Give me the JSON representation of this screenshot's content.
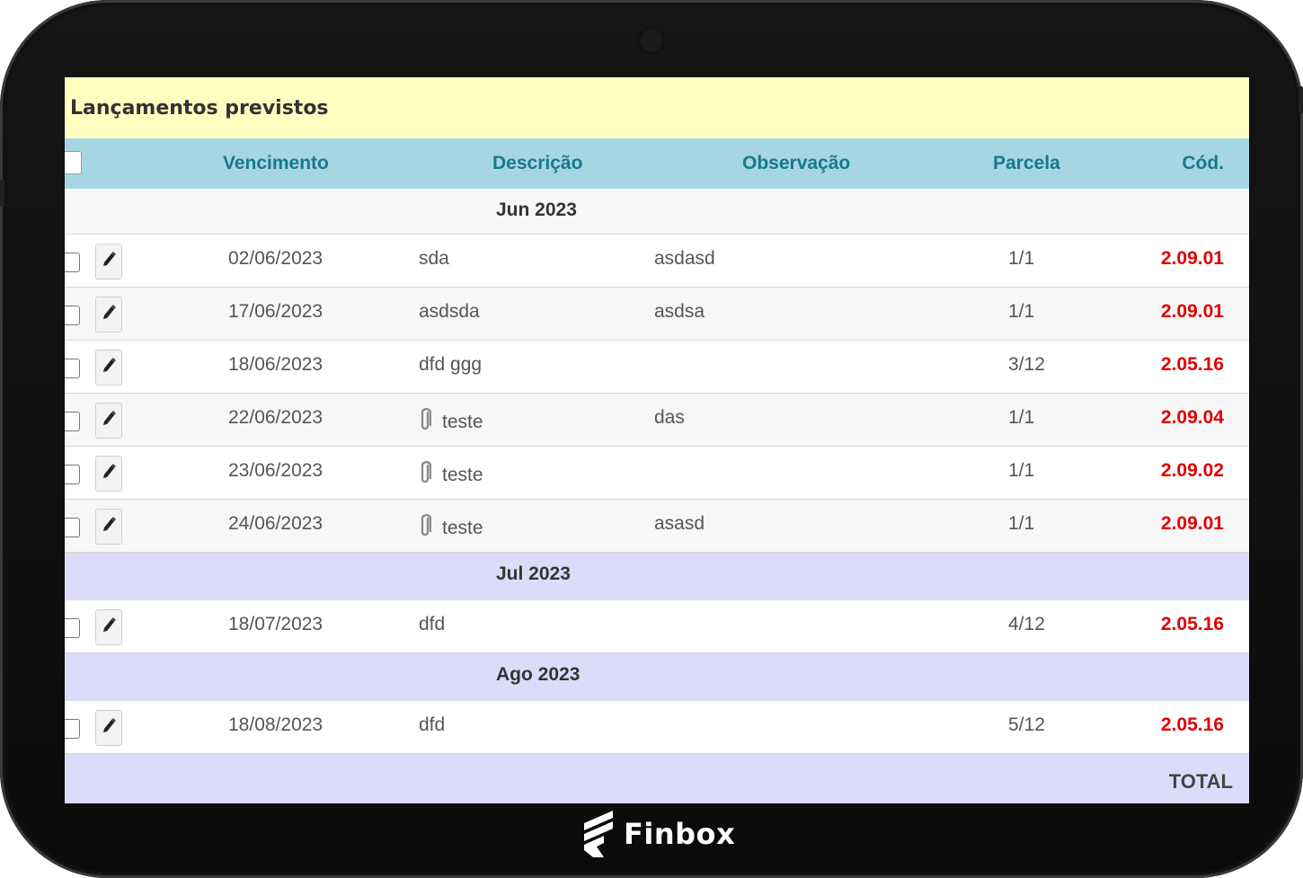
{
  "brand": {
    "name": "Finbox",
    "icon": "finbox-logo-icon"
  },
  "panel": {
    "title": "Lançamentos previstos"
  },
  "columns": {
    "vencimento": "Vencimento",
    "descricao": "Descrição",
    "observacao": "Observação",
    "parcela": "Parcela",
    "cod": "Cód."
  },
  "groups": [
    {
      "label": "Jun 2023",
      "rows": [
        {
          "vencimento": "02/06/2023",
          "descricao": "sda",
          "observacao": "asdasd",
          "parcela": "1/1",
          "cod": "2.09.01",
          "attachment": false
        },
        {
          "vencimento": "17/06/2023",
          "descricao": "asdsda",
          "observacao": "asdsa",
          "parcela": "1/1",
          "cod": "2.09.01",
          "attachment": false
        },
        {
          "vencimento": "18/06/2023",
          "descricao": "dfd ggg",
          "observacao": "",
          "parcela": "3/12",
          "cod": "2.05.16",
          "attachment": false
        },
        {
          "vencimento": "22/06/2023",
          "descricao": "teste",
          "observacao": "das",
          "parcela": "1/1",
          "cod": "2.09.04",
          "attachment": true
        },
        {
          "vencimento": "23/06/2023",
          "descricao": "teste",
          "observacao": "",
          "parcela": "1/1",
          "cod": "2.09.02",
          "attachment": true
        },
        {
          "vencimento": "24/06/2023",
          "descricao": "teste",
          "observacao": "asasd",
          "parcela": "1/1",
          "cod": "2.09.01",
          "attachment": true
        }
      ]
    },
    {
      "label": "Jul 2023",
      "rows": [
        {
          "vencimento": "18/07/2023",
          "descricao": "dfd",
          "observacao": "",
          "parcela": "4/12",
          "cod": "2.05.16",
          "attachment": false
        }
      ]
    },
    {
      "label": "Ago 2023",
      "rows": [
        {
          "vencimento": "18/08/2023",
          "descricao": "dfd",
          "observacao": "",
          "parcela": "5/12",
          "cod": "2.05.16",
          "attachment": false
        }
      ]
    }
  ],
  "footer": {
    "total_label": "TOTAL"
  },
  "colors": {
    "title_bg": "#ffffc2",
    "header_bg": "#a6d6e4",
    "header_text": "#177a89",
    "group_bg_first": "#f7f7f7",
    "group_bg": "#dcdcfa",
    "code_text": "#e00000"
  }
}
